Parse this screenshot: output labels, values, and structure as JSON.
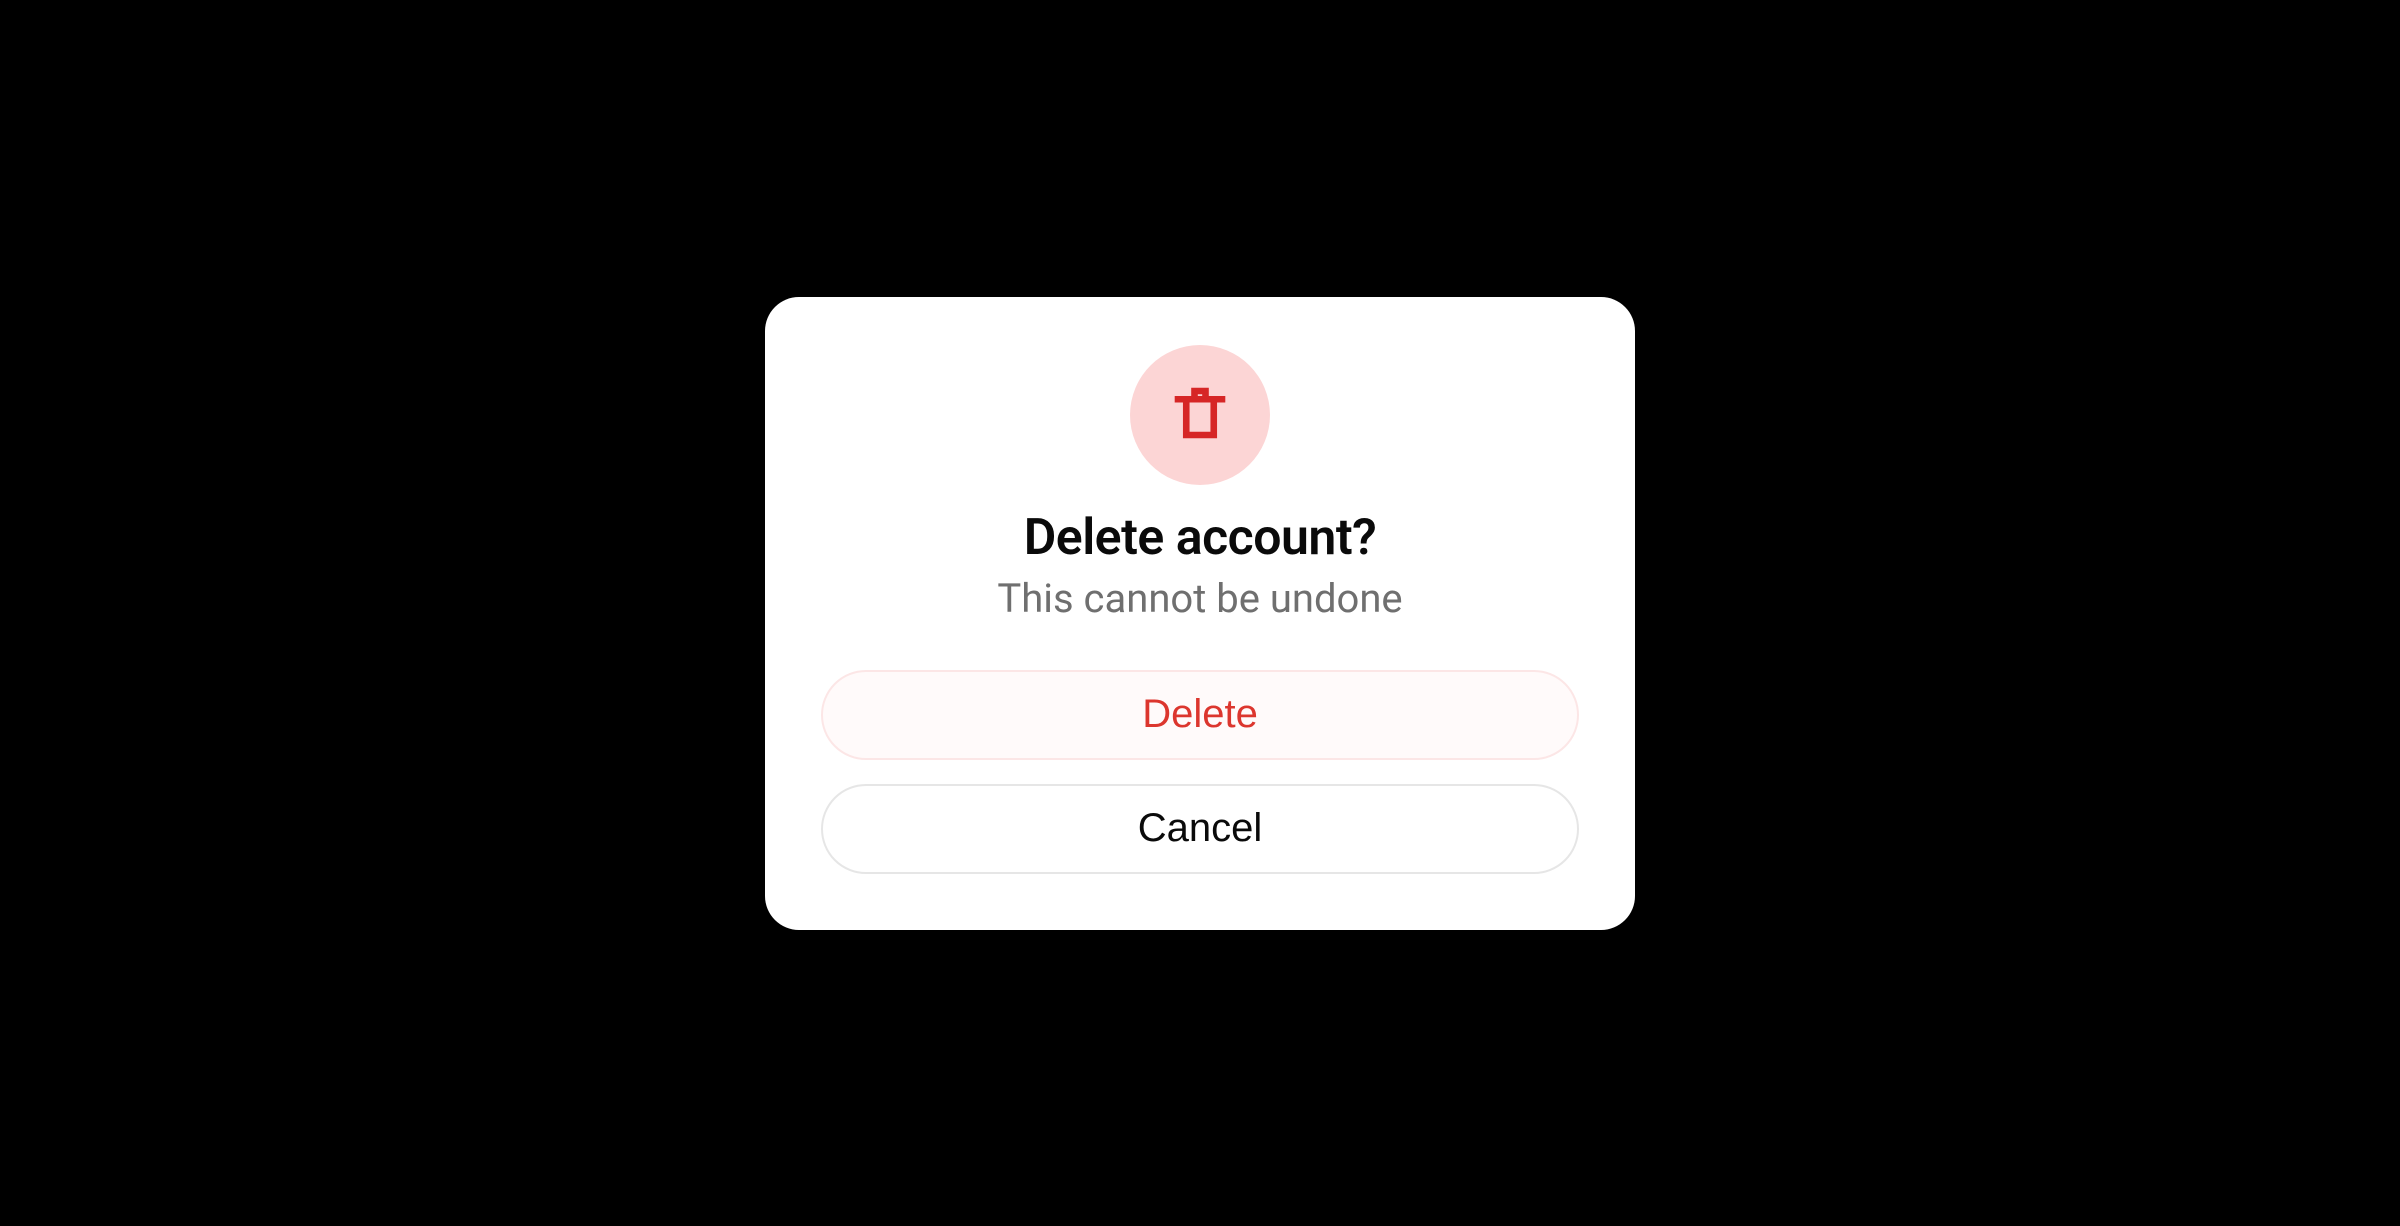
{
  "dialog": {
    "icon": "trash-icon",
    "title": "Delete account?",
    "subtitle": "This cannot be undone",
    "primary_label": "Delete",
    "secondary_label": "Cancel"
  },
  "colors": {
    "danger": "#dc362e",
    "icon_bg": "#fcd5d5",
    "text_muted": "#6f6f6f"
  }
}
